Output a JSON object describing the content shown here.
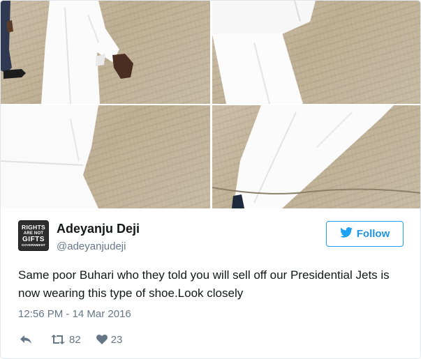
{
  "tweet": {
    "avatar_text": [
      "RIGHTS",
      "ARE NOT",
      "GIFTS",
      "GOVERNMENT"
    ],
    "display_name": "Adeyanju Deji",
    "username": "@adeyanjudeji",
    "follow_label": "Follow",
    "text": "Same poor Buhari who they told you will sell off our Presidential Jets is now wearing this type of shoe.Look closely",
    "timestamp": "12:56 PM - 14 Mar 2016",
    "retweet_count": "82",
    "like_count": "23"
  },
  "photos": [
    "man-in-white-walking-photo",
    "white-trousers-legs-photo",
    "white-robe-lower-photo",
    "white-trousers-shoe-photo"
  ],
  "icons": {
    "follow": "twitter-bird-icon",
    "reply": "reply-icon",
    "retweet": "retweet-icon",
    "like": "heart-icon"
  },
  "colors": {
    "brand_blue": "#1da1f2",
    "follow_text": "#1b95e0",
    "muted": "#657786",
    "text": "#14171a"
  }
}
